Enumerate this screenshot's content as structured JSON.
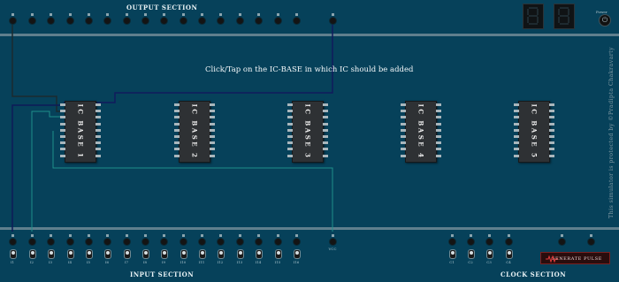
{
  "sections": {
    "output": "OUTPUT SECTION",
    "input": "INPUT SECTION",
    "clock": "CLOCK SECTION"
  },
  "instruction": "Click/Tap on the IC-BASE in which IC should be added",
  "credit": "This simulator is protected by ©Pradipta Chakravarty",
  "power": {
    "label": "Power",
    "icon": "power-icon",
    "glyph": "⏻"
  },
  "pulse_button": {
    "label": "GENERATE PULSE",
    "icon": "pulse-wave-icon"
  },
  "ic_bases": [
    {
      "label": "IC BASE 1"
    },
    {
      "label": "IC BASE 2"
    },
    {
      "label": "IC BASE 3"
    },
    {
      "label": "IC BASE 4"
    },
    {
      "label": "IC BASE 5"
    }
  ],
  "input_labels": [
    "I1",
    "I2",
    "I3",
    "I4",
    "I5",
    "I6",
    "I7",
    "I8",
    "I9",
    "I10",
    "I11",
    "I12",
    "I13",
    "I14",
    "I15",
    "I16"
  ],
  "vcc_label": "VCC",
  "clock_labels": [
    "C1",
    "C2",
    "C3",
    "C4"
  ],
  "seven_segment": {
    "digits": 2,
    "color": "#1e2a30"
  },
  "colors": {
    "board": "#06415a",
    "rail": "#5f7f8d",
    "wire_dark": "#1b2a2f",
    "wire_navy": "#101b5c",
    "wire_teal": "#1f8f8a",
    "pulse_button": "#2a0d0d"
  }
}
